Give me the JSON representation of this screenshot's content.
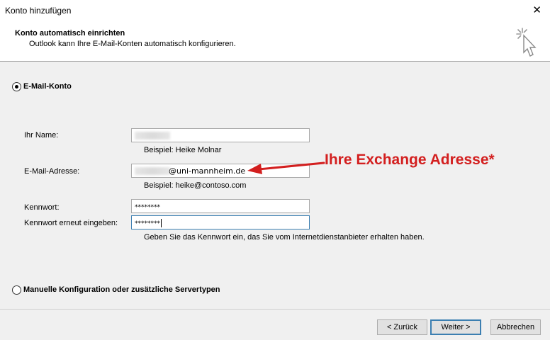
{
  "window": {
    "title": "Konto hinzufügen",
    "close_glyph": "✕"
  },
  "header": {
    "title": "Konto automatisch einrichten",
    "subtitle": "Outlook kann Ihre E-Mail-Konten automatisch konfigurieren.",
    "icon": "magic-wand-cursor-icon"
  },
  "email_account_option": {
    "label": "E-Mail-Konto",
    "selected": true
  },
  "form": {
    "name_label": "Ihr Name:",
    "name_value": "",
    "name_hint": "Beispiel: Heike Molnar",
    "email_label": "E-Mail-Adresse:",
    "email_value": "@uni-mannheim.de",
    "email_hint": "Beispiel: heike@contoso.com",
    "password_label": "Kennwort:",
    "password_value": "********",
    "password_confirm_label": "Kennwort erneut eingeben:",
    "password_confirm_value": "********",
    "password_hint": "Geben Sie das Kennwort ein, das Sie vom Internetdienstanbieter erhalten haben."
  },
  "annotation": {
    "text": "Ihre Exchange Adresse*",
    "color": "#d31f1f"
  },
  "manual_option": {
    "label": "Manuelle Konfiguration oder zusätzliche Servertypen",
    "selected": false
  },
  "buttons": {
    "back": "< Zurück",
    "next": "Weiter >",
    "cancel": "Abbrechen"
  }
}
